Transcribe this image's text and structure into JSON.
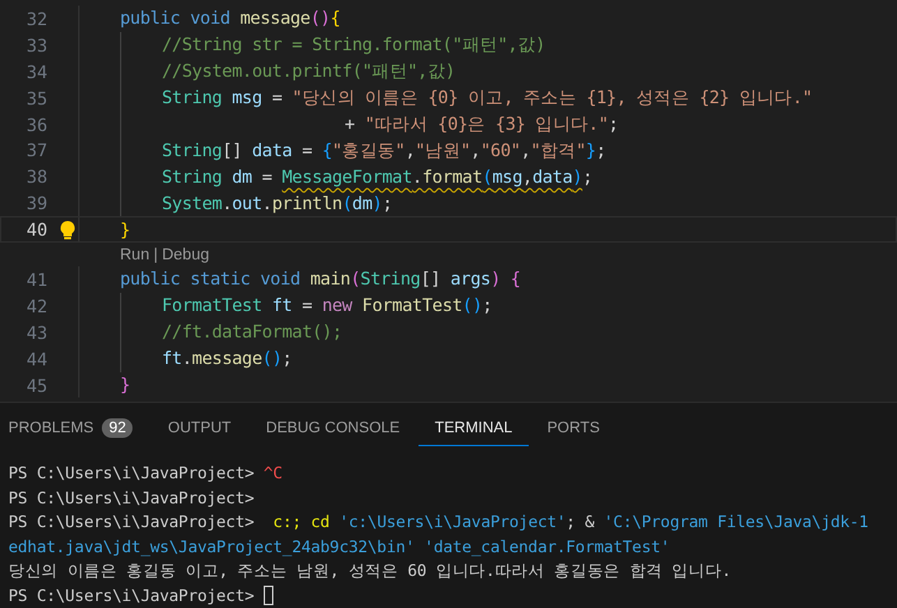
{
  "editor": {
    "lines": [
      {
        "kind": "code",
        "number": "32",
        "tokens": [
          {
            "kind": "keyword",
            "text": "public"
          },
          {
            "kind": "keyword",
            "text": " void"
          },
          {
            "kind": "func",
            "text": " message"
          },
          {
            "kind": "bracket2",
            "text": "()"
          },
          {
            "kind": "bracket1",
            "text": "{"
          }
        ],
        "children": [
          {
            "kind": "code",
            "number": "33",
            "tokens": [
              {
                "kind": "comment",
                "text": "//String str = String.format(\"패턴\",값)"
              }
            ]
          },
          {
            "kind": "code",
            "number": "34",
            "tokens": [
              {
                "kind": "comment",
                "text": "//System.out.printf(\"패턴\",값)"
              }
            ]
          },
          {
            "kind": "code",
            "number": "35",
            "tokens": [
              {
                "kind": "type",
                "text": "String"
              },
              {
                "kind": "var",
                "text": " msg"
              },
              {
                "kind": "plain",
                "text": " = "
              },
              {
                "kind": "string",
                "text": "\"당신의 이름은 {0} 이고, 주소는 {1}, 성적은 {2} 입니다.\""
              }
            ]
          },
          {
            "kind": "continuation",
            "number": "36",
            "tokens": [
              {
                "kind": "plain",
                "text": "+ "
              },
              {
                "kind": "string",
                "text": "\"따라서 {0}은 {3} 입니다.\""
              },
              {
                "kind": "plain",
                "text": ";"
              }
            ]
          },
          {
            "kind": "code",
            "number": "37",
            "tokens": [
              {
                "kind": "type",
                "text": "String"
              },
              {
                "kind": "plain",
                "text": "[] "
              },
              {
                "kind": "var",
                "text": "data"
              },
              {
                "kind": "plain",
                "text": " = "
              },
              {
                "kind": "bracket3",
                "text": "{"
              },
              {
                "kind": "string",
                "text": "\"홍길동\""
              },
              {
                "kind": "plain",
                "text": ","
              },
              {
                "kind": "string",
                "text": "\"남원\""
              },
              {
                "kind": "plain",
                "text": ","
              },
              {
                "kind": "string",
                "text": "\"60\""
              },
              {
                "kind": "plain",
                "text": ","
              },
              {
                "kind": "string",
                "text": "\"합격\""
              },
              {
                "kind": "bracket3",
                "text": "}"
              },
              {
                "kind": "plain",
                "text": ";"
              }
            ]
          },
          {
            "kind": "code",
            "number": "38",
            "tokens": [
              {
                "kind": "type",
                "text": "String"
              },
              {
                "kind": "var",
                "text": " dm"
              },
              {
                "kind": "plain",
                "text": " = "
              },
              {
                "kind": "warning",
                "tokens": [
                  {
                    "kind": "type",
                    "text": "MessageFormat"
                  },
                  {
                    "kind": "plain",
                    "text": "."
                  },
                  {
                    "kind": "func",
                    "text": "format"
                  },
                  {
                    "kind": "bracket3",
                    "text": "("
                  },
                  {
                    "kind": "var",
                    "text": "msg"
                  },
                  {
                    "kind": "plain",
                    "text": ","
                  },
                  {
                    "kind": "var",
                    "text": "data"
                  },
                  {
                    "kind": "bracket3",
                    "text": ")"
                  }
                ]
              },
              {
                "kind": "plain",
                "text": ";"
              }
            ]
          },
          {
            "kind": "code",
            "number": "39",
            "tokens": [
              {
                "kind": "type",
                "text": "System"
              },
              {
                "kind": "plain",
                "text": "."
              },
              {
                "kind": "var",
                "text": "out"
              },
              {
                "kind": "plain",
                "text": "."
              },
              {
                "kind": "func",
                "text": "println"
              },
              {
                "kind": "bracket3",
                "text": "("
              },
              {
                "kind": "var",
                "text": "dm"
              },
              {
                "kind": "bracket3",
                "text": ")"
              },
              {
                "kind": "plain",
                "text": ";"
              }
            ]
          }
        ]
      },
      {
        "kind": "code",
        "number": "40",
        "current": true,
        "lightbulb": true,
        "tokens": [
          {
            "kind": "bracket1",
            "text": "}"
          }
        ]
      },
      {
        "kind": "codelens",
        "items": [
          {
            "kind": "link",
            "text": "Run"
          },
          {
            "kind": "separator",
            "text": "|"
          },
          {
            "kind": "link",
            "text": "Debug"
          }
        ]
      },
      {
        "kind": "code",
        "number": "41",
        "tokens": [
          {
            "kind": "keyword",
            "text": "public"
          },
          {
            "kind": "keyword",
            "text": " static"
          },
          {
            "kind": "keyword",
            "text": " void"
          },
          {
            "kind": "func",
            "text": " main"
          },
          {
            "kind": "bracket2",
            "text": "("
          },
          {
            "kind": "type",
            "text": "String"
          },
          {
            "kind": "plain",
            "text": "[] "
          },
          {
            "kind": "var",
            "text": "args"
          },
          {
            "kind": "bracket2",
            "text": ")"
          },
          {
            "kind": "bracket2",
            "text": " {"
          }
        ],
        "children": [
          {
            "kind": "code",
            "number": "42",
            "tokens": [
              {
                "kind": "type",
                "text": "FormatTest"
              },
              {
                "kind": "var",
                "text": " ft"
              },
              {
                "kind": "plain",
                "text": " = "
              },
              {
                "kind": "control",
                "text": "new"
              },
              {
                "kind": "func",
                "text": " FormatTest"
              },
              {
                "kind": "bracket3",
                "text": "()"
              },
              {
                "kind": "plain",
                "text": ";"
              }
            ]
          },
          {
            "kind": "code",
            "number": "43",
            "tokens": [
              {
                "kind": "comment",
                "text": "//ft.dataFormat();"
              }
            ]
          },
          {
            "kind": "code",
            "number": "44",
            "tokens": [
              {
                "kind": "var",
                "text": "ft"
              },
              {
                "kind": "plain",
                "text": "."
              },
              {
                "kind": "func",
                "text": "message"
              },
              {
                "kind": "bracket3",
                "text": "()"
              },
              {
                "kind": "plain",
                "text": ";"
              }
            ]
          }
        ]
      },
      {
        "kind": "code",
        "number": "45",
        "tokens": [
          {
            "kind": "bracket2",
            "text": "}"
          }
        ]
      }
    ]
  },
  "panel": {
    "tabs": [
      {
        "label": "PROBLEMS",
        "badge": "92",
        "selected": false
      },
      {
        "label": "OUTPUT",
        "selected": false
      },
      {
        "label": "DEBUG CONSOLE",
        "selected": false
      },
      {
        "label": "TERMINAL",
        "selected": true
      },
      {
        "label": "PORTS",
        "selected": false
      }
    ]
  },
  "terminal": {
    "lines": [
      [
        {
          "kind": "plain",
          "text": "PS C:\\Users\\i\\JavaProject> "
        },
        {
          "kind": "error",
          "text": "^C"
        }
      ],
      [
        {
          "kind": "plain",
          "text": "PS C:\\Users\\i\\JavaProject>"
        }
      ],
      [
        {
          "kind": "plain",
          "text": "PS C:\\Users\\i\\JavaProject>  "
        },
        {
          "kind": "command",
          "text": "c:;"
        },
        {
          "kind": "command",
          "text": " cd"
        },
        {
          "kind": "string",
          "text": " 'c:\\Users\\i\\JavaProject'"
        },
        {
          "kind": "plain",
          "text": "; & "
        },
        {
          "kind": "string",
          "text": "'C:\\Program Files\\Java\\jdk-1"
        }
      ],
      [
        {
          "kind": "string",
          "text": "edhat.java\\jdt_ws\\JavaProject_24ab9c32\\bin'"
        },
        {
          "kind": "string",
          "text": " 'date_calendar.FormatTest'"
        }
      ],
      [
        {
          "kind": "plain",
          "text": "당신의 이름은 홍길동 이고, 주소는 남원, 성적은 60 입니다.따라서 홍길동은 합격 입니다."
        }
      ],
      [
        {
          "kind": "plain",
          "text": "PS C:\\Users\\i\\JavaProject> "
        },
        {
          "kind": "cursor"
        }
      ]
    ]
  }
}
